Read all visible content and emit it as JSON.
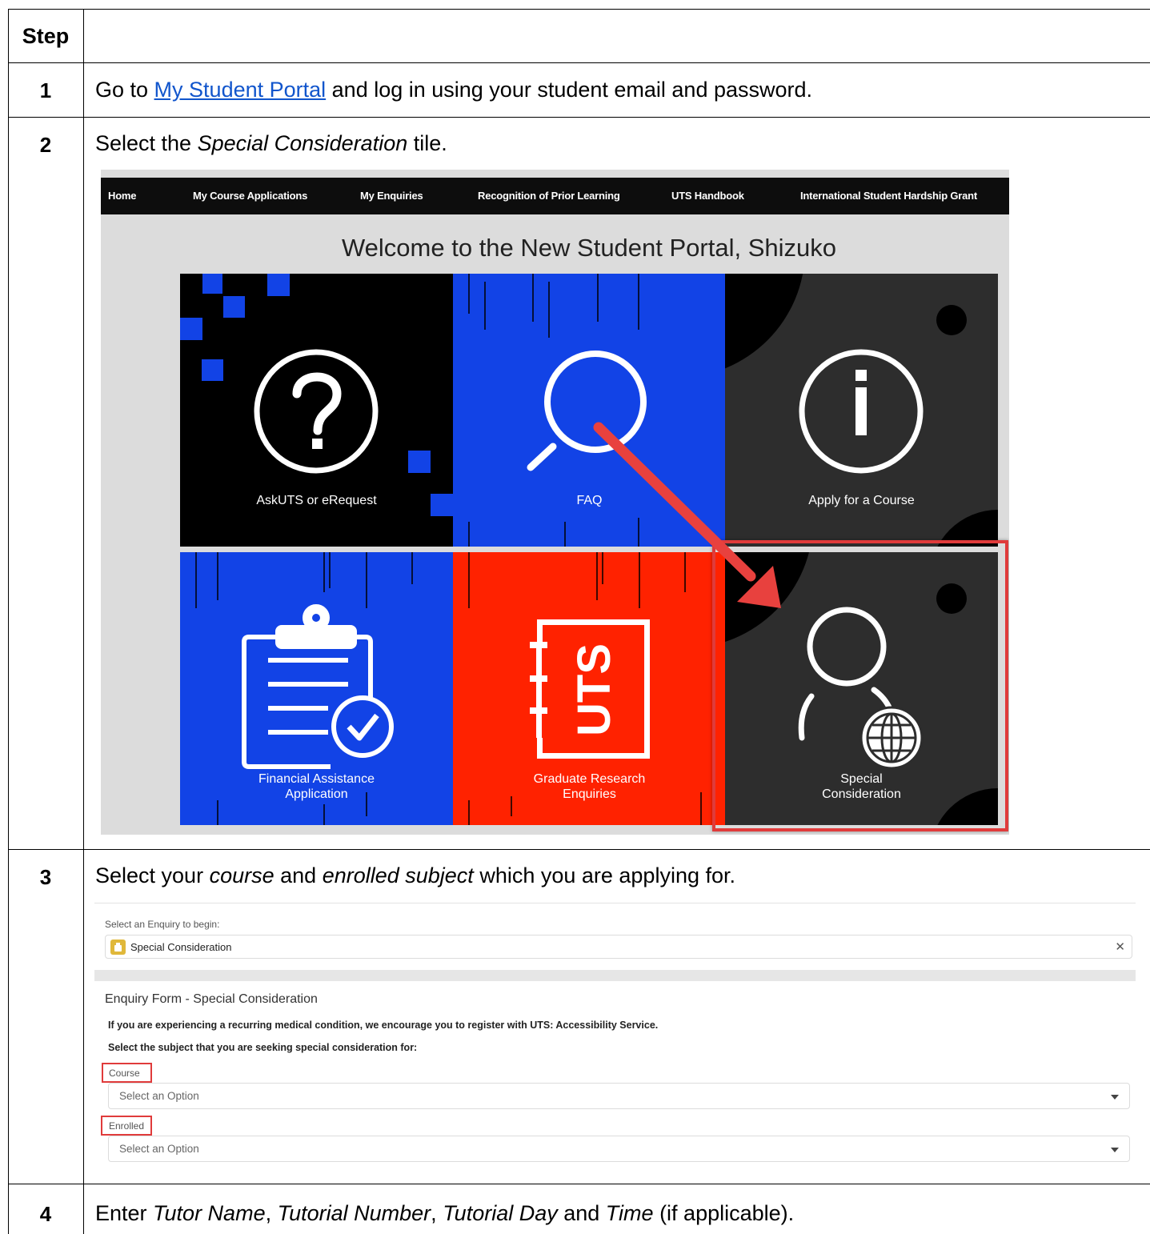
{
  "table": {
    "header": "Step",
    "steps": [
      {
        "num": "1",
        "before": "Go to ",
        "link": "My Student Portal",
        "after": " and log  in using your student email and password."
      },
      {
        "num": "2",
        "before": "Select the ",
        "em": "Special Consideration",
        "after": " tile."
      },
      {
        "num": "3",
        "before": "Select your ",
        "em1": "course",
        "mid": " and ",
        "em2": "enrolled subject",
        "after": " which you are applying for."
      },
      {
        "num": "4",
        "before": "Enter ",
        "em1": "Tutor Name",
        "sep1": ", ",
        "em2": "Tutorial Number",
        "sep2": ", ",
        "em3": "Tutorial Day",
        "mid": " and ",
        "em4": "Time",
        "after": " (if applicable)."
      }
    ]
  },
  "portal": {
    "nav": [
      "Home",
      "My Course Applications",
      "My Enquiries",
      "Recognition of Prior Learning",
      "UTS Handbook",
      "International Student Hardship Grant"
    ],
    "welcome": "Welcome to the New Student Portal, Shizuko",
    "tiles": [
      {
        "label": "AskUTS or eRequest",
        "icon": "question-icon",
        "color": "#000000"
      },
      {
        "label": "FAQ",
        "icon": "search-icon",
        "color": "#1243e6"
      },
      {
        "label": "Apply for a Course",
        "icon": "info-icon",
        "color": "#2d2d2d"
      },
      {
        "label1": "Financial Assistance",
        "label2": "Application",
        "icon": "clipboard-check-icon",
        "color": "#1243e6"
      },
      {
        "label1": "Graduate Research",
        "label2": "Enquiries",
        "icon": "uts-logo-icon",
        "color": "#ff2200"
      },
      {
        "label1": "Special",
        "label2": "Consideration",
        "icon": "person-globe-icon",
        "color": "#2d2d2d"
      }
    ],
    "highlight_color": "#e03b3b",
    "arrow_color": "#e8413e"
  },
  "form": {
    "enquiry_prompt": "Select an Enquiry to begin:",
    "enquiry_value": "Special Consideration",
    "clear_symbol": "✕",
    "form_title": "Enquiry Form - Special Consideration",
    "notice": "If you are experiencing a recurring medical condition, we encourage you to register with UTS: Accessibility Service.",
    "instruction": "Select the subject that you are seeking special consideration for:",
    "course_label": "Course",
    "course_placeholder": "Select an Option",
    "enrolled_label": "Enrolled",
    "enrolled_placeholder": "Select an Option"
  }
}
